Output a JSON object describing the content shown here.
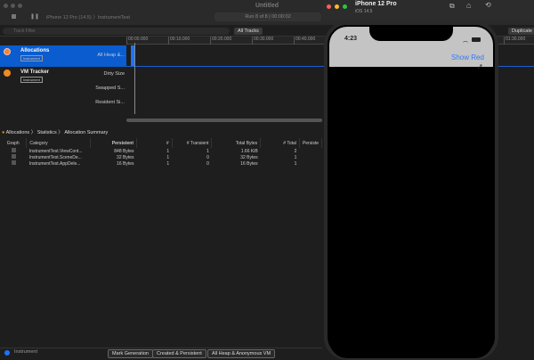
{
  "window": {
    "title": "Untitled",
    "device": "iPhone 12 Pro (14.5)",
    "target": "InstrumentTest",
    "run_status": "Run 8 of 8  |  00:00:02"
  },
  "filter": {
    "placeholder": "Track Filter",
    "all_tracks": "All Tracks",
    "duplicate": "Duplicate"
  },
  "timeline": {
    "ticks": [
      "00:00.000",
      "00:10.000",
      "00:20.000",
      "00:30.000",
      "00:40.000",
      "01:30.000"
    ]
  },
  "tracks": [
    {
      "name": "Allocations",
      "badge": "Instrument",
      "lanes": [
        "All Heap &..."
      ]
    },
    {
      "name": "VM Tracker",
      "badge": "Instrument",
      "lanes": [
        "Dirty Size",
        "Swapped S...",
        "Resident Si..."
      ]
    }
  ],
  "breadcrumb": [
    "Allocations",
    "Statistics",
    "Allocation Summary"
  ],
  "table": {
    "columns": [
      "Graph",
      "Category",
      "Persistent",
      "#",
      "# Transient",
      "Total Bytes",
      "# Total",
      "Persiste"
    ],
    "rows": [
      [
        "InstrumentTest.ViewCont...",
        "848 Bytes",
        "1",
        "1",
        "1.66 KiB",
        "2"
      ],
      [
        "InstrumentTest.SceneDe...",
        "32 Bytes",
        "1",
        "0",
        "32 Bytes",
        "1"
      ],
      [
        "InstrumentTest.AppDele...",
        "16 Bytes",
        "1",
        "0",
        "16 Bytes",
        "1"
      ]
    ]
  },
  "bottom": {
    "filter_value": "Instrument",
    "mark_generation": "Mark Generation",
    "mode": "Created & Persistent",
    "heap": "All Heap & Anonymous VM"
  },
  "simulator": {
    "device": "iPhone 12 Pro",
    "os": "iOS 14.5",
    "time": "4:23",
    "nav_button": "Show Red",
    "accent": "#3478f6"
  }
}
